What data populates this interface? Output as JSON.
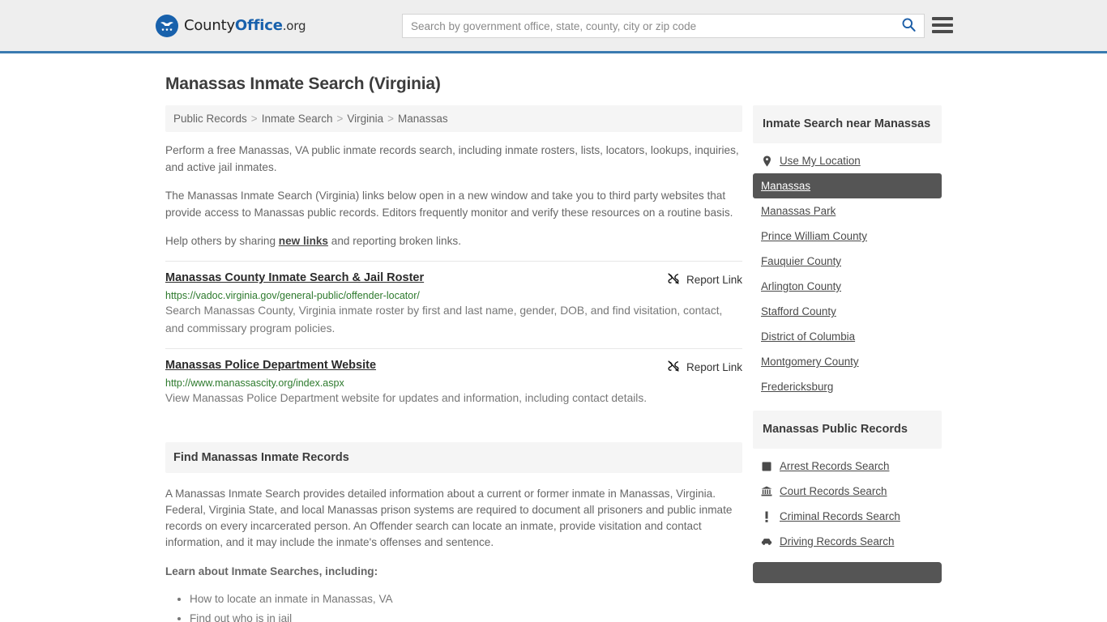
{
  "header": {
    "logo": {
      "part1": "County",
      "part2": "Office",
      "part3": ".org",
      "icon": "eagle-seal-icon"
    },
    "search": {
      "placeholder": "Search by government office, state, county, city or zip code",
      "value": ""
    },
    "search_icon": "search-icon",
    "menu_icon": "hamburger-menu-icon"
  },
  "page": {
    "title": "Manassas Inmate Search (Virginia)"
  },
  "breadcrumb": {
    "items": [
      "Public Records",
      "Inmate Search",
      "Virginia",
      "Manassas"
    ],
    "separator": ">"
  },
  "intro": {
    "p1": "Perform a free Manassas, VA public inmate records search, including inmate rosters, lists, locators, lookups, inquiries, and active jail inmates.",
    "p2": "The Manassas Inmate Search (Virginia) links below open in a new window and take you to third party websites that provide access to Manassas public records. Editors frequently monitor and verify these resources on a routine basis.",
    "p3_before": "Help others by sharing ",
    "p3_link": "new links",
    "p3_after": " and reporting broken links."
  },
  "results": [
    {
      "title": "Manassas County Inmate Search & Jail Roster",
      "url": "https://vadoc.virginia.gov/general-public/offender-locator/",
      "description": "Search Manassas County, Virginia inmate roster by first and last name, gender, DOB, and find visitation, contact, and commissary program policies.",
      "report_label": "Report Link",
      "report_icon": "broken-link-icon"
    },
    {
      "title": "Manassas Police Department Website",
      "url": "http://www.manassascity.org/index.aspx",
      "description": "View Manassas Police Department website for updates and information, including contact details.",
      "report_label": "Report Link",
      "report_icon": "broken-link-icon"
    }
  ],
  "section": {
    "heading": "Find Manassas Inmate Records",
    "paragraph": "A Manassas Inmate Search provides detailed information about a current or former inmate in Manassas, Virginia. Federal, Virginia State, and local Manassas prison systems are required to document all prisoners and public inmate records on every incarcerated person. An Offender search can locate an inmate, provide visitation and contact information, and it may include the inmate's offenses and sentence.",
    "subheading": "Learn about Inmate Searches, including:",
    "list": [
      "How to locate an inmate in Manassas, VA",
      "Find out who is in jail"
    ]
  },
  "sidebar": {
    "nearby": {
      "heading": "Inmate Search near Manassas",
      "items": [
        {
          "label": "Use My Location",
          "icon": "map-pin-icon",
          "active": false
        },
        {
          "label": "Manassas",
          "icon": "",
          "active": true
        },
        {
          "label": "Manassas Park",
          "icon": "",
          "active": false
        },
        {
          "label": "Prince William County",
          "icon": "",
          "active": false
        },
        {
          "label": "Fauquier County",
          "icon": "",
          "active": false
        },
        {
          "label": "Arlington County",
          "icon": "",
          "active": false
        },
        {
          "label": "Stafford County",
          "icon": "",
          "active": false
        },
        {
          "label": "District of Columbia",
          "icon": "",
          "active": false
        },
        {
          "label": "Montgomery County",
          "icon": "",
          "active": false
        },
        {
          "label": "Fredericksburg",
          "icon": "",
          "active": false
        }
      ]
    },
    "public_records": {
      "heading": "Manassas Public Records",
      "items": [
        {
          "label": "Arrest Records Search",
          "icon": "fingerprint-square-icon"
        },
        {
          "label": "Court Records Search",
          "icon": "courthouse-icon"
        },
        {
          "label": "Criminal Records Search",
          "icon": "exclamation-icon"
        },
        {
          "label": "Driving Records Search",
          "icon": "car-icon"
        }
      ]
    }
  },
  "colors": {
    "header_bg": "#eeeeee",
    "header_border": "#3a7ab0",
    "brand_blue": "#1861ac",
    "url_green": "#2d7a2d",
    "active_bg": "#555555",
    "panel_bg": "#f5f5f5"
  }
}
